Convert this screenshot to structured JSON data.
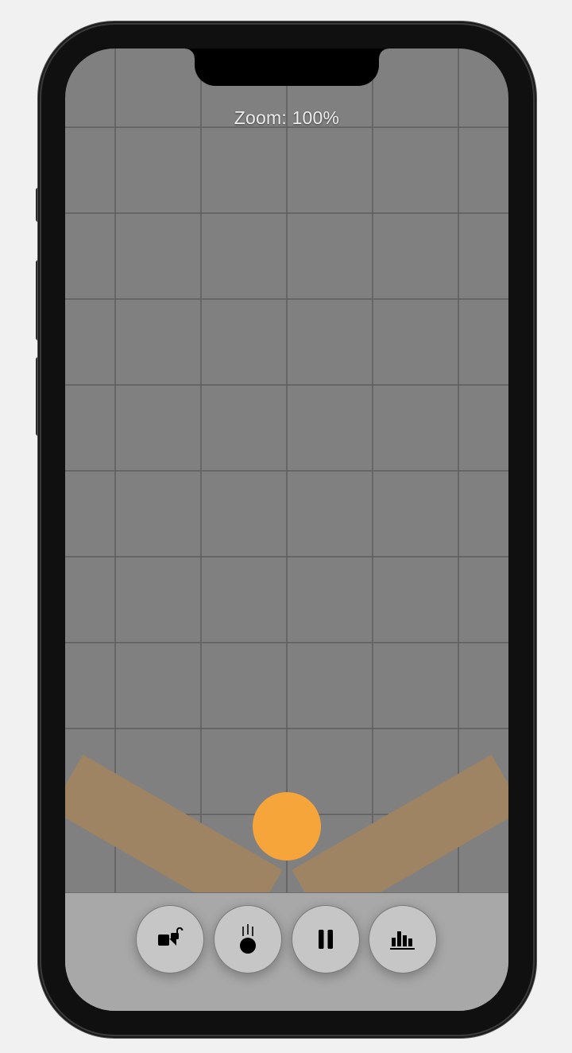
{
  "canvas": {
    "zoom_text": "Zoom: 100%",
    "zoom_percent": 100,
    "background_color": "#808080",
    "grid_color": "#5e5e5e",
    "grid": true
  },
  "objects": {
    "ball_color": "#f5a53a",
    "plank_color": "#9e8463"
  },
  "toolbar": {
    "background_color": "#a8a8a8",
    "buttons": [
      {
        "id": "lock-toggle",
        "icon": "unlock-shapes-icon"
      },
      {
        "id": "drop-ball",
        "icon": "falling-ball-icon"
      },
      {
        "id": "pause",
        "icon": "pause-icon"
      },
      {
        "id": "stats",
        "icon": "bar-chart-icon"
      }
    ]
  }
}
